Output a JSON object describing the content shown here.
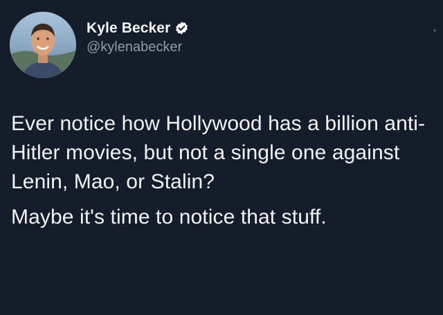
{
  "tweet": {
    "author": {
      "display_name": "Kyle Becker",
      "handle": "@kylenabecker",
      "verified": true,
      "avatar_icon": "profile-photo"
    },
    "more_icon": "more-options-icon",
    "paragraphs": [
      "Ever notice how Hollywood has a billion anti-Hitler movies, but not a single one against Lenin, Mao, or Stalin?",
      "Maybe it's time to notice that stuff."
    ],
    "colors": {
      "background": "#141d29",
      "text": "#f2f4f6",
      "secondary_text": "#8f9ba8",
      "verified_badge": "#ffffff"
    }
  }
}
